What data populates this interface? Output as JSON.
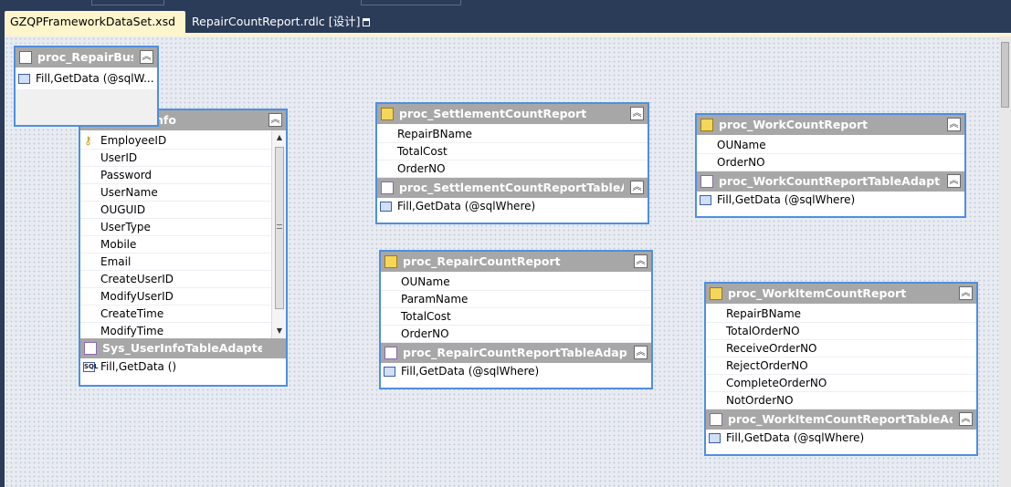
{
  "tabs": [
    {
      "label": "GZQPFrameworkDataSet.xsd"
    },
    {
      "label": "RepairCountReport.rdlc [设计]"
    }
  ],
  "icons": {
    "table": "table-icon",
    "adapter": "table-adapter-icon",
    "method": "method-icon",
    "sql": "sql-method-icon",
    "key": "primary-key-icon",
    "collapse": "collapse-chevron-icon"
  },
  "tables": {
    "repair_business": {
      "title": "proc_RepairBusine",
      "method": "Fill,GetData (@sqlW..."
    },
    "user_info": {
      "title": "nfo",
      "columns": [
        "EmployeeID",
        "UserID",
        "Password",
        "UserName",
        "OUGUID",
        "UserType",
        "Mobile",
        "Email",
        "CreateUserID",
        "ModifyUserID",
        "CreateTime",
        "ModifyTime"
      ],
      "adapter": "Sys_UserInfoTableAdapter",
      "method": "Fill,GetData ()"
    },
    "settlement": {
      "title": "proc_SettlementCountReport",
      "columns": [
        "RepairBName",
        "TotalCost",
        "OrderNO"
      ],
      "adapter": "proc_SettlementCountReportTableAdapter",
      "method": "Fill,GetData (@sqlWhere)"
    },
    "work": {
      "title": "proc_WorkCountReport",
      "columns": [
        "OUName",
        "OrderNO"
      ],
      "adapter": "proc_WorkCountReportTableAdapter",
      "method": "Fill,GetData (@sqlWhere)"
    },
    "repair": {
      "title": "proc_RepairCountReport",
      "columns": [
        "OUName",
        "ParamName",
        "TotalCost",
        "OrderNO"
      ],
      "adapter": "proc_RepairCountReportTableAdapter",
      "method": "Fill,GetData (@sqlWhere)"
    },
    "work_item": {
      "title": "proc_WorkItemCountReport",
      "columns": [
        "RepairBName",
        "TotalOrderNO",
        "ReceiveOrderNO",
        "RejectOrderNO",
        "CompleteOrderNO",
        "NotOrderNO"
      ],
      "adapter": "proc_WorkItemCountReportTableAdapter",
      "method": "Fill,GetData (@sqlWhere)"
    }
  }
}
